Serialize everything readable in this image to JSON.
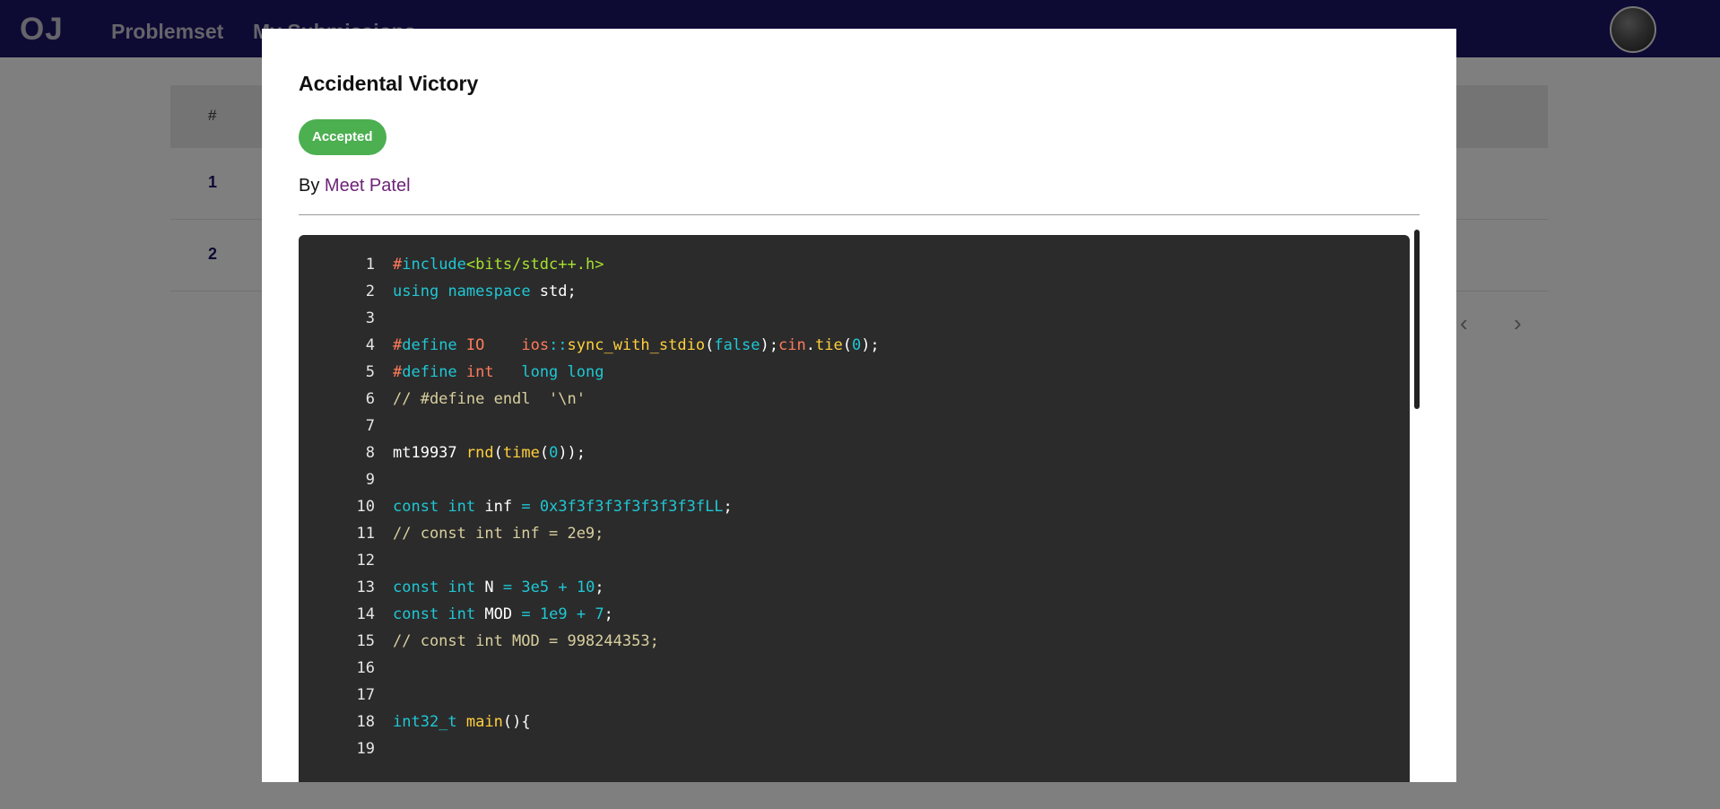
{
  "navbar": {
    "brand": "OJ",
    "links": [
      "Problemset",
      "My Submissions"
    ]
  },
  "table": {
    "header_num": "#",
    "rows": [
      "1",
      "2"
    ]
  },
  "pager": {
    "prev": "‹",
    "next": "›"
  },
  "modal": {
    "title": "Accidental Victory",
    "status": "Accepted",
    "by_label": "By",
    "author": "Meet Patel"
  },
  "code": {
    "lines": [
      [
        [
          "pp",
          "#"
        ],
        [
          "kw",
          "include"
        ],
        [
          "str",
          "<bits/stdc++.h>"
        ]
      ],
      [
        [
          "kw",
          "using"
        ],
        [
          "pn",
          " "
        ],
        [
          "kw",
          "namespace"
        ],
        [
          "id",
          " std;"
        ]
      ],
      [],
      [
        [
          "pp",
          "#"
        ],
        [
          "kw",
          "define"
        ],
        [
          "pp",
          " IO"
        ],
        [
          "pn",
          "    "
        ],
        [
          "ns",
          "ios"
        ],
        [
          "op",
          "::"
        ],
        [
          "fn",
          "sync_with_stdio"
        ],
        [
          "pn",
          "("
        ],
        [
          "kw",
          "false"
        ],
        [
          "pn",
          ");"
        ],
        [
          "ns",
          "cin"
        ],
        [
          "pn",
          "."
        ],
        [
          "fn",
          "tie"
        ],
        [
          "pn",
          "("
        ],
        [
          "num",
          "0"
        ],
        [
          "pn",
          ");"
        ]
      ],
      [
        [
          "pp",
          "#"
        ],
        [
          "kw",
          "define"
        ],
        [
          "pp",
          " int"
        ],
        [
          "pn",
          "   "
        ],
        [
          "kw",
          "long long"
        ]
      ],
      [
        [
          "cm",
          "// #define endl  '\\n'"
        ]
      ],
      [],
      [
        [
          "id",
          "mt19937 "
        ],
        [
          "fn",
          "rnd"
        ],
        [
          "pn",
          "("
        ],
        [
          "fn",
          "time"
        ],
        [
          "pn",
          "("
        ],
        [
          "num",
          "0"
        ],
        [
          "pn",
          "));"
        ]
      ],
      [],
      [
        [
          "kw",
          "const"
        ],
        [
          "pn",
          " "
        ],
        [
          "kw",
          "int"
        ],
        [
          "id",
          " inf "
        ],
        [
          "op",
          "="
        ],
        [
          "pn",
          " "
        ],
        [
          "num",
          "0x3f3f3f3f3f3f3f3fLL"
        ],
        [
          "pn",
          ";"
        ]
      ],
      [
        [
          "cm",
          "// const int inf = 2e9;"
        ]
      ],
      [],
      [
        [
          "kw",
          "const"
        ],
        [
          "pn",
          " "
        ],
        [
          "kw",
          "int"
        ],
        [
          "id",
          " N "
        ],
        [
          "op",
          "="
        ],
        [
          "pn",
          " "
        ],
        [
          "num",
          "3e5"
        ],
        [
          "pn",
          " "
        ],
        [
          "op",
          "+"
        ],
        [
          "pn",
          " "
        ],
        [
          "num",
          "10"
        ],
        [
          "pn",
          ";"
        ]
      ],
      [
        [
          "kw",
          "const"
        ],
        [
          "pn",
          " "
        ],
        [
          "kw",
          "int"
        ],
        [
          "id",
          " MOD "
        ],
        [
          "op",
          "="
        ],
        [
          "pn",
          " "
        ],
        [
          "num",
          "1e9"
        ],
        [
          "pn",
          " "
        ],
        [
          "op",
          "+"
        ],
        [
          "pn",
          " "
        ],
        [
          "num",
          "7"
        ],
        [
          "pn",
          ";"
        ]
      ],
      [
        [
          "cm",
          "// const int MOD = 998244353;"
        ]
      ],
      [],
      [],
      [
        [
          "kw",
          "int32_t"
        ],
        [
          "pn",
          " "
        ],
        [
          "fn",
          "main"
        ],
        [
          "pn",
          "(){"
        ]
      ],
      []
    ]
  }
}
